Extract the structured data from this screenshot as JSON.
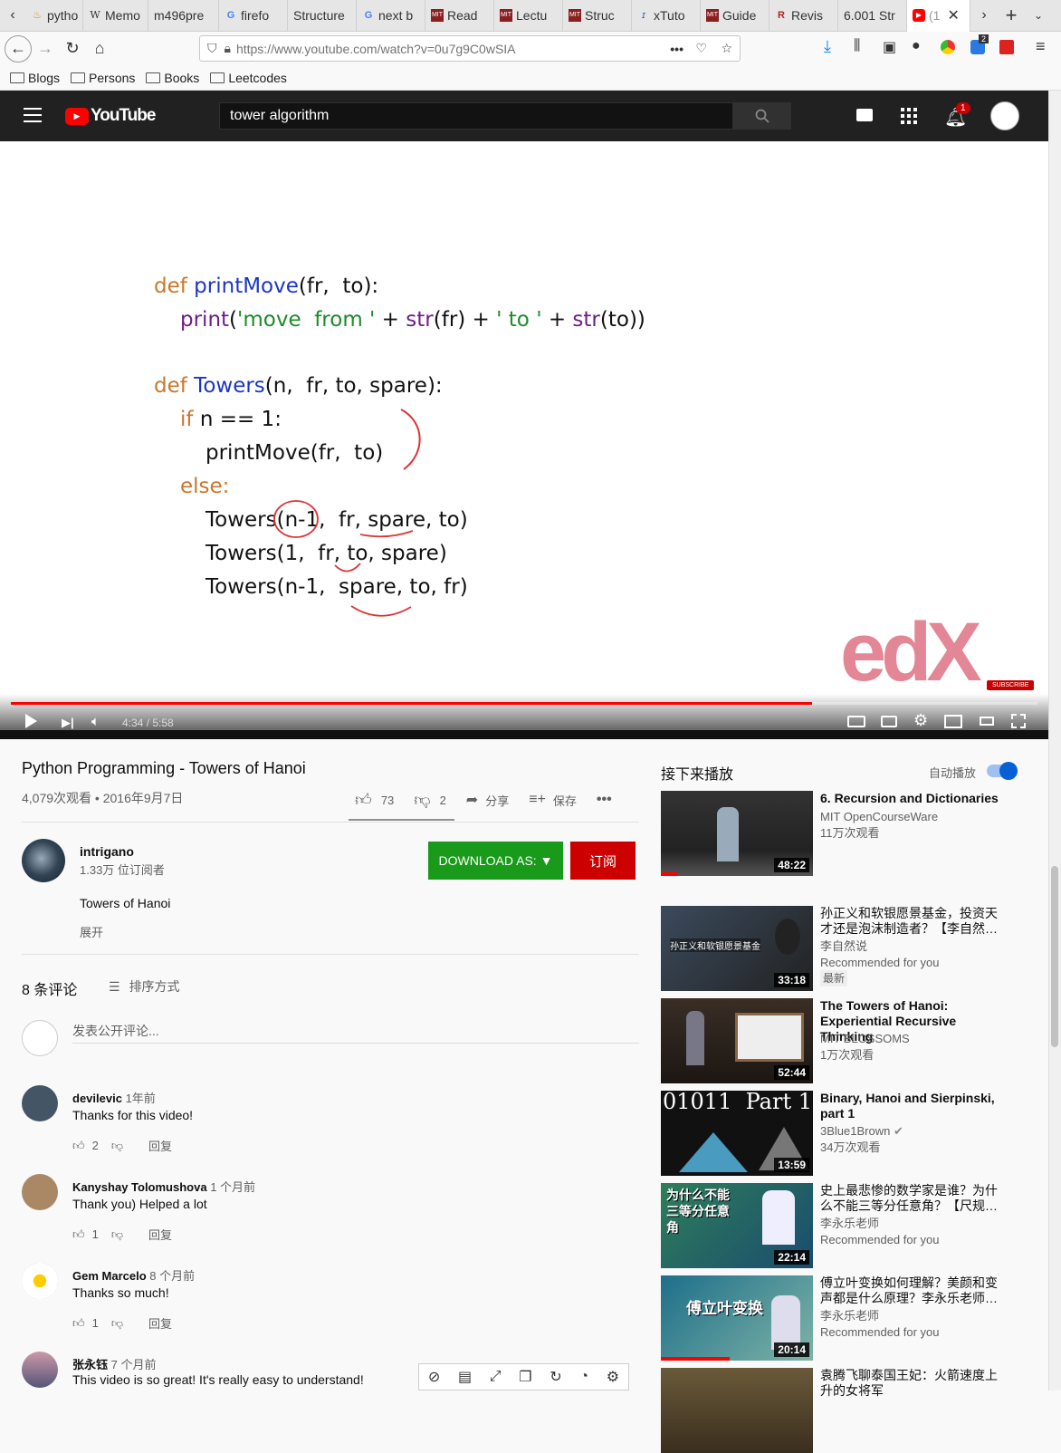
{
  "browser": {
    "tabs": [
      {
        "label": "pytho",
        "icon": "python-icon"
      },
      {
        "label": "Memo",
        "icon": "wikipedia-icon"
      },
      {
        "label": "m496pre",
        "icon": "blank-icon"
      },
      {
        "label": "firefo",
        "icon": "google-icon"
      },
      {
        "label": "Structure",
        "icon": "blank-icon"
      },
      {
        "label": "next b",
        "icon": "google-icon"
      },
      {
        "label": "Read",
        "icon": "mit-ocw-icon"
      },
      {
        "label": "Lectu",
        "icon": "mit-ocw-icon"
      },
      {
        "label": "Struc",
        "icon": "mit-ocw-icon"
      },
      {
        "label": "xTuto",
        "icon": "xtutor-icon"
      },
      {
        "label": "Guide",
        "icon": "mit-ocw-icon"
      },
      {
        "label": "Revis",
        "icon": "r-icon"
      },
      {
        "label": "6.001 Str",
        "icon": "blank-icon"
      },
      {
        "label": "(1",
        "icon": "youtube-icon"
      }
    ],
    "url": "https://www.youtube.com/watch?v=0u7g9C0wSIA",
    "bookmarks": [
      "Blogs",
      "Persons",
      "Books",
      "Leetcodes"
    ],
    "ext_badge": "2"
  },
  "youtube": {
    "logo_text": "YouTube",
    "search_value": "tower algorithm",
    "notif_count": "1"
  },
  "video": {
    "code_lines": [
      "def printMove(fr,  to):",
      "print('move  from ' + str(fr) + ' to ' + str(to))",
      "def Towers(n,  fr, to, spare):",
      "if n == 1:",
      "printMove(fr,  to)",
      "else:",
      "Towers(n-1,  fr, spare, to)",
      "Towers(1,  fr, to, spare)",
      "Towers(n-1,  spare, to, fr)"
    ],
    "watermark": "edX",
    "subscribe_badge": "SUBSCRIBE",
    "time": "4:34 / 5:58",
    "progress": 0.7805
  },
  "info": {
    "title": "Python Programming - Towers of Hanoi",
    "views": "4,079次观看 • 2016年9月7日",
    "likes": "73",
    "dislikes": "2",
    "share": "分享",
    "save": "保存",
    "channel": "intrigano",
    "subscribers": "1.33万 位订阅者",
    "download_label": "DOWNLOAD AS: ▼",
    "subscribe_label": "订阅",
    "description": "Towers of Hanoi",
    "expand": "展开",
    "comments_count": "8 条评论",
    "sort_label": "排序方式",
    "comment_placeholder": "发表公开评论...",
    "reply": "回复"
  },
  "comments": [
    {
      "author": "devilevic",
      "time": "1年前",
      "text": "Thanks for this video!",
      "likes": "2"
    },
    {
      "author": "Kanyshay Tolomushova",
      "time": "1 个月前",
      "text": "Thank you) Helped a lot",
      "likes": "1"
    },
    {
      "author": "Gem Marcelo",
      "time": "8 个月前",
      "text": "Thanks so much!",
      "likes": "1"
    },
    {
      "author": "张永钰",
      "time": "7 个月前",
      "text": "This video is so great! It's really easy to understand!",
      "likes": ""
    }
  ],
  "sidebar": {
    "up_next": "接下来播放",
    "autoplay": "自动播放",
    "items": [
      {
        "title": "6. Recursion and Dictionaries",
        "channel": "MIT OpenCourseWare",
        "views": "11万次观看",
        "extra": "",
        "duration": "48:22",
        "thumb_text": ""
      },
      {
        "title": "孙正义和软银愿景基金，投资天才还是泡沫制造者？【李自然…",
        "channel": "李自然说",
        "views": "Recommended for you",
        "extra": "最新",
        "duration": "33:18",
        "thumb_text": "孙正义和软银愿景基金"
      },
      {
        "title": "The Towers of Hanoi: Experiential Recursive Thinking",
        "channel": "MIT BLOSSOMS",
        "views": "1万次观看",
        "extra": "",
        "duration": "52:44",
        "thumb_text": ""
      },
      {
        "title": "Binary, Hanoi and Sierpinski, part 1",
        "channel": "3Blue1Brown",
        "views": "34万次观看",
        "extra": "",
        "duration": "13:59",
        "thumb_text": "01011  Part 1"
      },
      {
        "title": "史上最悲惨的数学家是谁？为什么不能三等分任意角？【尺规…",
        "channel": "李永乐老师",
        "views": "Recommended for you",
        "extra": "",
        "duration": "22:14",
        "thumb_text": "为什么不能三等分任意角"
      },
      {
        "title": "傅立叶变换如何理解？美颜和变声都是什么原理？李永乐老师…",
        "channel": "李永乐老师",
        "views": "Recommended for you",
        "extra": "",
        "duration": "20:14",
        "thumb_text": "傅立叶变换"
      },
      {
        "title": "袁腾飞聊泰国王妃：火箭速度上升的女将军",
        "channel": "",
        "views": "",
        "extra": "",
        "duration": "",
        "thumb_text": ""
      }
    ]
  },
  "colors": {
    "yt_red": "#ff0000",
    "download_green": "#1a9a1a",
    "subscribe_red": "#cc0000",
    "toggle_blue": "#065fd4"
  }
}
